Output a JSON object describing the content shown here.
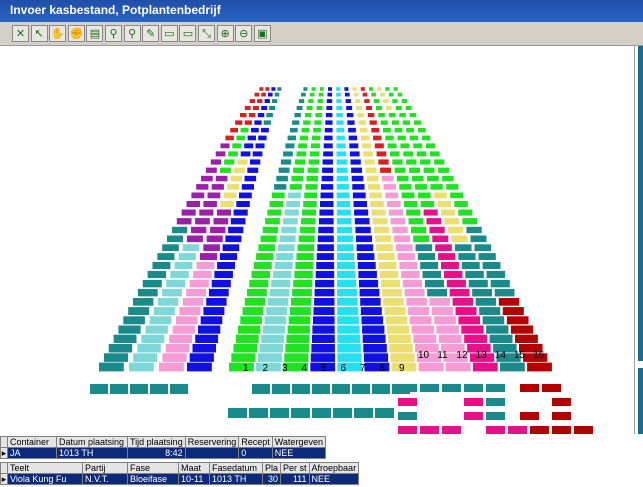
{
  "window": {
    "title": "Invoer kasbestand, Potplantenbedrijf"
  },
  "toolbar": {
    "buttons": [
      {
        "name": "close-icon",
        "glyph": "✕"
      },
      {
        "name": "pointer-icon",
        "glyph": "↖"
      },
      {
        "name": "hand-icon",
        "glyph": "✋"
      },
      {
        "name": "grab-icon",
        "glyph": "✊"
      },
      {
        "name": "table-icon",
        "glyph": "▤"
      },
      {
        "name": "binoculars-icon",
        "glyph": "⚲"
      },
      {
        "name": "binoculars-next-icon",
        "glyph": "⚲"
      },
      {
        "name": "edit-icon",
        "glyph": "✎"
      },
      {
        "name": "move-icon",
        "glyph": "▭"
      },
      {
        "name": "move-many-icon",
        "glyph": "▭"
      },
      {
        "name": "resize-icon",
        "glyph": "⤡"
      },
      {
        "name": "zoom-in-icon",
        "glyph": "⊕"
      },
      {
        "name": "zoom-out-icon",
        "glyph": "⊖"
      },
      {
        "name": "save-icon",
        "glyph": "▣"
      }
    ]
  },
  "beds": {
    "numbers": [
      "1",
      "2",
      "3",
      "4",
      "5",
      "6",
      "7",
      "8",
      "9",
      "10",
      "11",
      "12",
      "13",
      "14",
      "15",
      "16"
    ],
    "colors": {
      "teal": "#1a8a8a",
      "lightblue": "#7fd8d8",
      "pink": "#f59bd6",
      "blue": "#1010e0",
      "green": "#22e022",
      "purple": "#9b1fa8",
      "yellow": "#eadf70",
      "red": "#d82020",
      "magenta": "#e8108a",
      "darkred": "#b30000",
      "cyan": "#26e0f0",
      "mint": "#8bd8bf"
    }
  },
  "container_grid": {
    "headers": [
      "Container",
      "Datum plaatsing",
      "Tijd plaatsing",
      "Reservering",
      "Recept",
      "Watergeven"
    ],
    "row": [
      "JA",
      "1013 TH",
      "8:42",
      "",
      "0",
      "NEE"
    ]
  },
  "plant_grid": {
    "headers": [
      "Teelt",
      "Partij",
      "Fase",
      "Maat",
      "Fasedatum",
      "Pla",
      "Per st",
      "Afroepbaar"
    ],
    "row": [
      "Viola Kung Fu",
      "N.V.T.",
      "Bloeifase",
      "10-11",
      "1013 TH",
      "30",
      "111",
      "NEE"
    ]
  }
}
